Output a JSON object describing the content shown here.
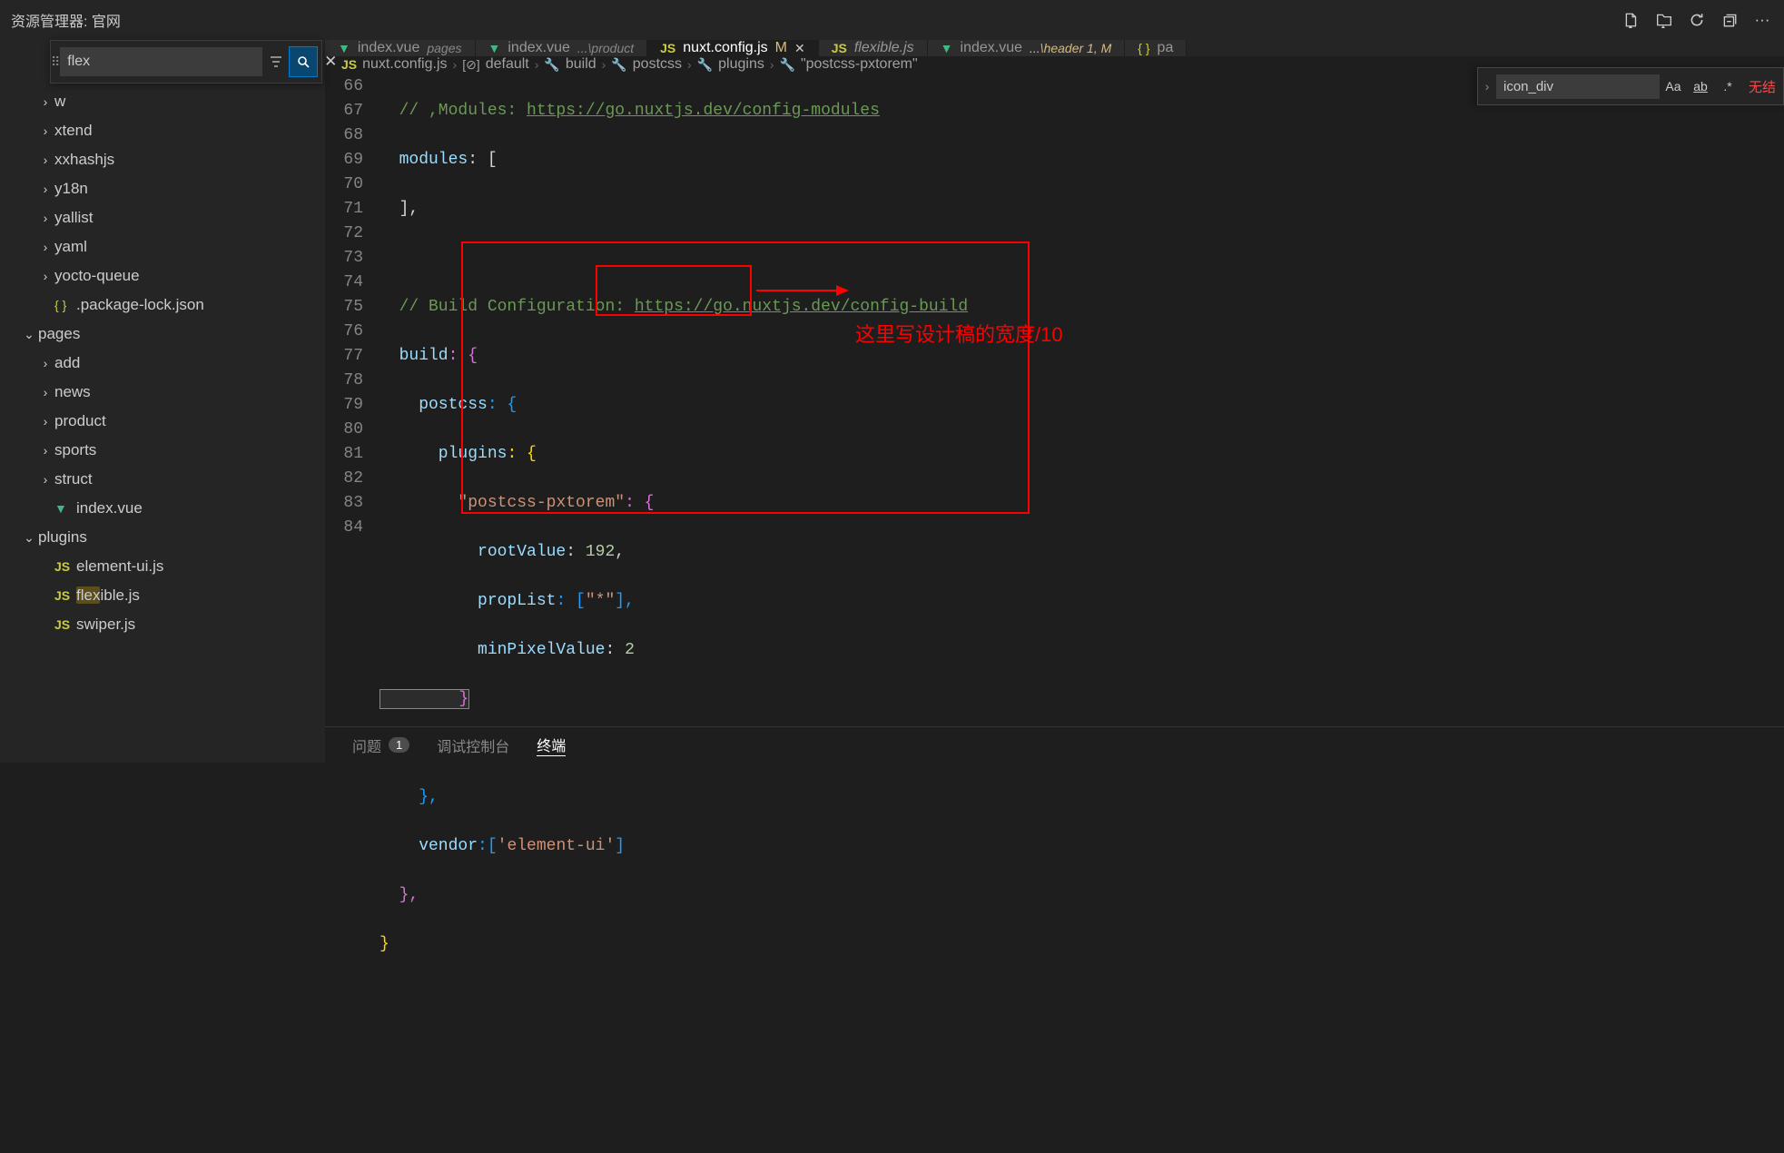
{
  "titleBar": {
    "label": "资源管理器: 官网"
  },
  "sidebarSearch": {
    "value": "flex"
  },
  "tree": {
    "top": [
      {
        "label": "w"
      },
      {
        "label": "xtend"
      },
      {
        "label": "xxhashjs"
      },
      {
        "label": "y18n"
      },
      {
        "label": "yallist"
      },
      {
        "label": "yaml"
      },
      {
        "label": "yocto-queue"
      }
    ],
    "packageLock": ".package-lock.json",
    "pages": "pages",
    "pagesChildren": [
      "add",
      "news",
      "product",
      "sports",
      "struct"
    ],
    "pagesIndex": "index.vue",
    "plugins": "plugins",
    "pluginFiles": [
      "element-ui.js",
      "flexible.js",
      "swiper.js"
    ]
  },
  "tabs": [
    {
      "icon": "vue",
      "name": "index.vue",
      "desc": "pages"
    },
    {
      "icon": "vue",
      "name": "index.vue",
      "desc": "...\\product"
    },
    {
      "icon": "js",
      "name": "nuxt.config.js",
      "mod": "M",
      "active": true,
      "close": true
    },
    {
      "icon": "js",
      "name": "flexible.js",
      "italic": true
    },
    {
      "icon": "vue",
      "name": "index.vue",
      "desc": "...\\header 1, M",
      "modDesc": true
    },
    {
      "icon": "json",
      "name": "pa"
    }
  ],
  "breadcrumbs": [
    "nuxt.config.js",
    "default",
    "build",
    "postcss",
    "plugins",
    "\"postcss-pxtorem\""
  ],
  "gutter": [
    "66",
    "67",
    "68",
    "69",
    "70",
    "71",
    "72",
    "73",
    "74",
    "75",
    "76",
    "77",
    "78",
    "79",
    "80",
    "81",
    "82",
    "83",
    "84"
  ],
  "code": {
    "l66a": "  // ,Modules: ",
    "l66b": "https://go.nuxtjs.dev/config-modules",
    "l67a": "  modules",
    "l67b": ": [",
    "l68": "  ],",
    "l70a": "  // Build Configuration: ",
    "l70b": "https://go.nuxtjs.dev/config-build",
    "l71a": "  build",
    "l71b": ": {",
    "l72a": "    postcss",
    "l72b": ": {",
    "l73a": "      plugins",
    "l73b": ": {",
    "l74a": "        ",
    "l74b": "\"postcss-pxtorem\"",
    "l74c": ": {",
    "l75a": "          rootValue",
    "l75b": ": ",
    "l75c": "192",
    "l75d": ",",
    "l76a": "          propList",
    "l76b": ": [",
    "l76c": "\"*\"",
    "l76d": "],",
    "l77a": "          minPixelValue",
    "l77b": ": ",
    "l77c": "2",
    "l78": "        }",
    "l79": "      }",
    "l80": "    },",
    "l81a": "    vendor",
    "l81b": ":[",
    "l81c": "'element-ui'",
    "l81d": "]",
    "l82": "  },",
    "l83": "}"
  },
  "annotation": "这里写设计稿的宽度/10",
  "findWidget": {
    "value": "icon_div",
    "noResults": "无结"
  },
  "panel": {
    "problems": "问题",
    "problemsCount": "1",
    "debug": "调试控制台",
    "terminal": "终端"
  }
}
